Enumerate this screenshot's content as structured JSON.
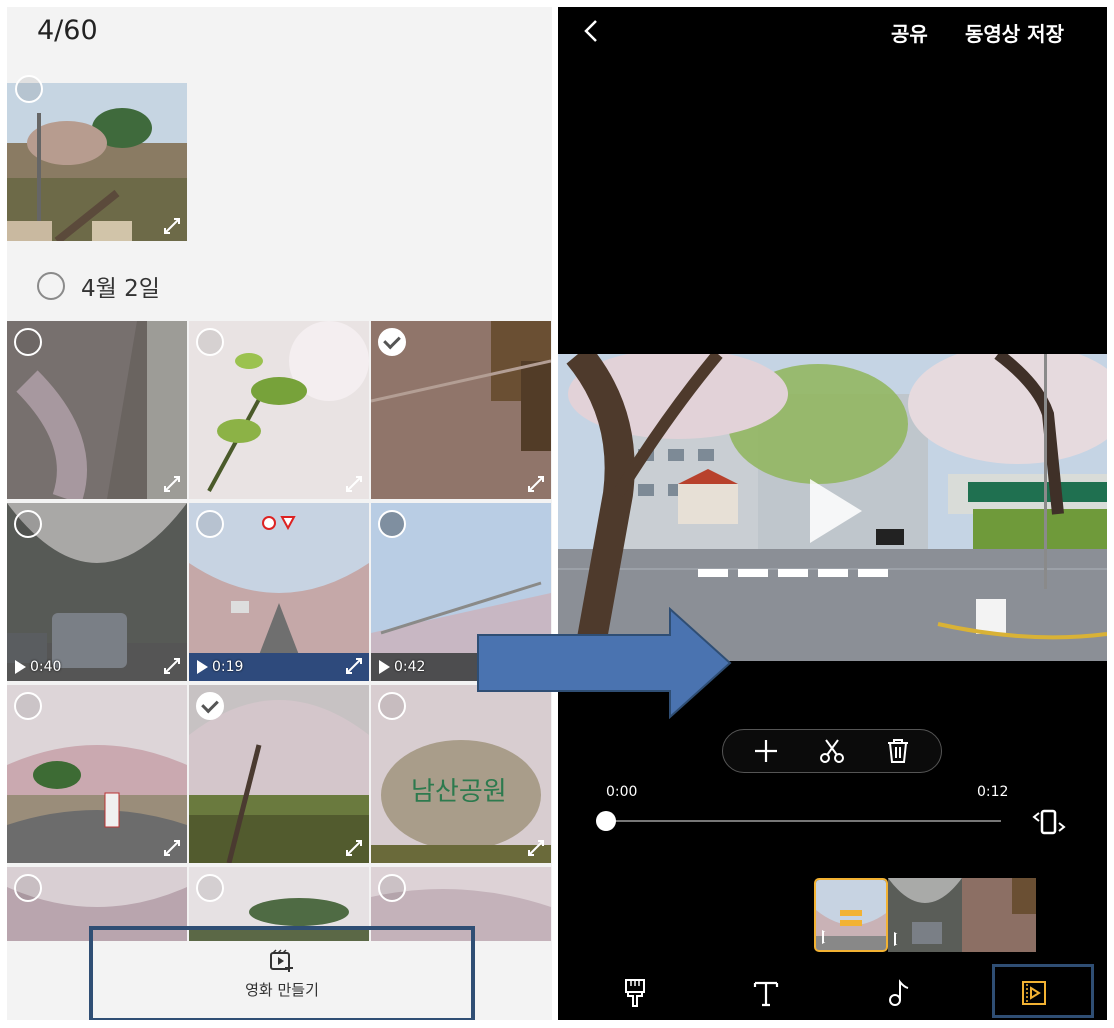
{
  "gallery": {
    "selection_count": "4/60",
    "date_header": "4월 2일",
    "video_durations": [
      "0:40",
      "0:19",
      "0:42"
    ],
    "make_movie_label": "영화 만들기"
  },
  "editor": {
    "back_icon": "chevron-left-icon",
    "share_label": "공유",
    "save_label": "동영상 저장",
    "time_start": "0:00",
    "time_end": "0:12",
    "progress": 0,
    "tools": [
      "add-icon",
      "scissors-icon",
      "trash-icon"
    ],
    "bottom_tools": [
      "brush-icon",
      "text-icon",
      "music-icon",
      "storyboard-icon"
    ],
    "accent": "#f2b233"
  },
  "annotation": {
    "highlight_color": "#2f4e74",
    "arrow_color": "#4a73b0"
  }
}
